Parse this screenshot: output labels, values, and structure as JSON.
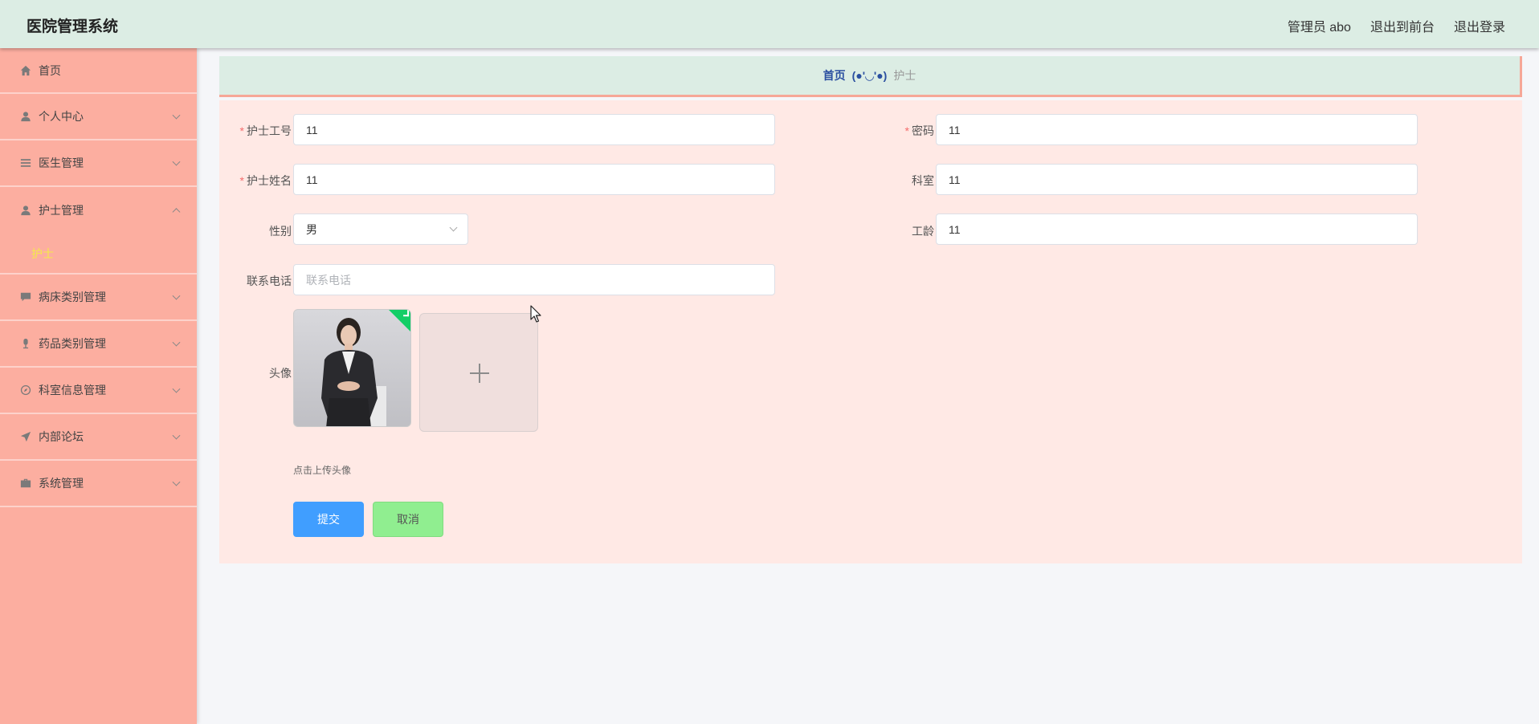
{
  "header": {
    "title": "医院管理系统",
    "user": "管理员 abo",
    "to_front": "退出到前台",
    "logout": "退出登录"
  },
  "sidebar": {
    "items": [
      {
        "label": "首页",
        "icon": "home-icon"
      },
      {
        "label": "个人中心",
        "icon": "user-icon"
      },
      {
        "label": "医生管理",
        "icon": "list-icon"
      },
      {
        "label": "护士管理",
        "icon": "user-icon",
        "expanded": true,
        "children": [
          {
            "label": "护士"
          }
        ]
      },
      {
        "label": "病床类别管理",
        "icon": "chat-icon"
      },
      {
        "label": "药品类别管理",
        "icon": "microphone-icon"
      },
      {
        "label": "科室信息管理",
        "icon": "compass-icon"
      },
      {
        "label": "内部论坛",
        "icon": "send-icon"
      },
      {
        "label": "系统管理",
        "icon": "briefcase-icon"
      }
    ]
  },
  "breadcrumb": {
    "home": "首页",
    "separator": "(●'◡'●)",
    "current": "护士"
  },
  "form": {
    "nurse_id": {
      "label": "护士工号",
      "value": "11",
      "required": true
    },
    "password": {
      "label": "密码",
      "value": "11",
      "required": true
    },
    "nurse_name": {
      "label": "护士姓名",
      "value": "11",
      "required": true
    },
    "department": {
      "label": "科室",
      "value": "11"
    },
    "gender": {
      "label": "性别",
      "value": "男"
    },
    "seniority": {
      "label": "工龄",
      "value": "11"
    },
    "phone": {
      "label": "联系电话",
      "value": "",
      "placeholder": "联系电话"
    },
    "avatar": {
      "label": "头像",
      "tip": "点击上传头像"
    },
    "submit": "提交",
    "cancel": "取消"
  },
  "colors": {
    "header_bg": "#dcede4",
    "sidebar_bg": "#fcaea0",
    "panel_bg": "#ffe9e5",
    "submit_bg": "#409eff",
    "cancel_bg": "#90ee90",
    "active_sub": "#f5e94a"
  }
}
